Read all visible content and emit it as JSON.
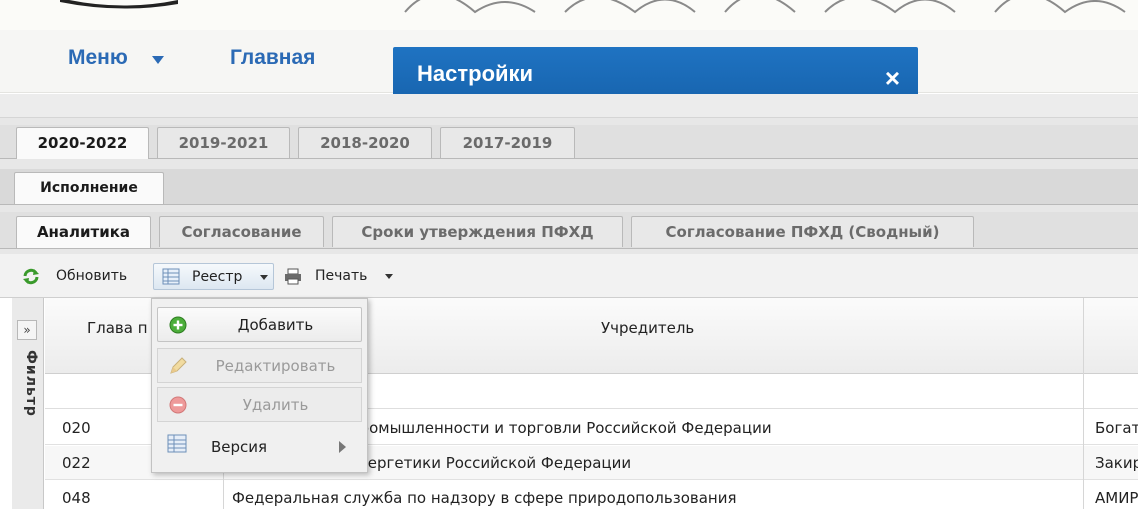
{
  "nav": {
    "menu_label": "Меню",
    "home_label": "Главная",
    "active_tab_label": "Настройки",
    "close_label": "×"
  },
  "year_tabs": [
    {
      "label": "2020-2022",
      "active": true
    },
    {
      "label": "2019-2021",
      "active": false
    },
    {
      "label": "2018-2020",
      "active": false
    },
    {
      "label": "2017-2019",
      "active": false
    }
  ],
  "section_tab": {
    "label": "Исполнение"
  },
  "sub_tabs": [
    {
      "label": "Аналитика",
      "active": true
    },
    {
      "label": "Согласование",
      "active": false
    },
    {
      "label": "Сроки утверждения ПФХД",
      "active": false
    },
    {
      "label": "Согласование ПФХД (Сводный)",
      "active": false
    }
  ],
  "toolbar": {
    "refresh_label": "Обновить",
    "registry_label": "Реестр",
    "print_label": "Печать"
  },
  "filter_panel": {
    "expand_label": "»",
    "label": "Фильтр"
  },
  "grid": {
    "columns": [
      {
        "header": "Глава п"
      },
      {
        "header": "Учредитель"
      },
      {
        "header": ""
      }
    ],
    "rows": [
      {
        "code": "020",
        "founder": "Министерство промышленности и торговли Российской Федерации",
        "extra": "Богат"
      },
      {
        "code": "022",
        "founder": "Министерство энергетики Российской Федерации",
        "extra": "Закир"
      },
      {
        "code": "048",
        "founder": "Федеральная служба по надзору в сфере природопользования",
        "extra": "АМИР"
      }
    ]
  },
  "registry_menu": {
    "items": [
      {
        "label": "Добавить",
        "state": "hover",
        "icon": "add-icon"
      },
      {
        "label": "Редактировать",
        "state": "disabled",
        "icon": "pencil-icon"
      },
      {
        "label": "Удалить",
        "state": "disabled",
        "icon": "delete-icon"
      },
      {
        "label": "Версия",
        "state": "normal",
        "icon": "table-icon",
        "has_submenu": true
      }
    ]
  },
  "colors": {
    "nav_blue": "#2b6ab5",
    "active_tab_bg": "#1a6ab8"
  }
}
